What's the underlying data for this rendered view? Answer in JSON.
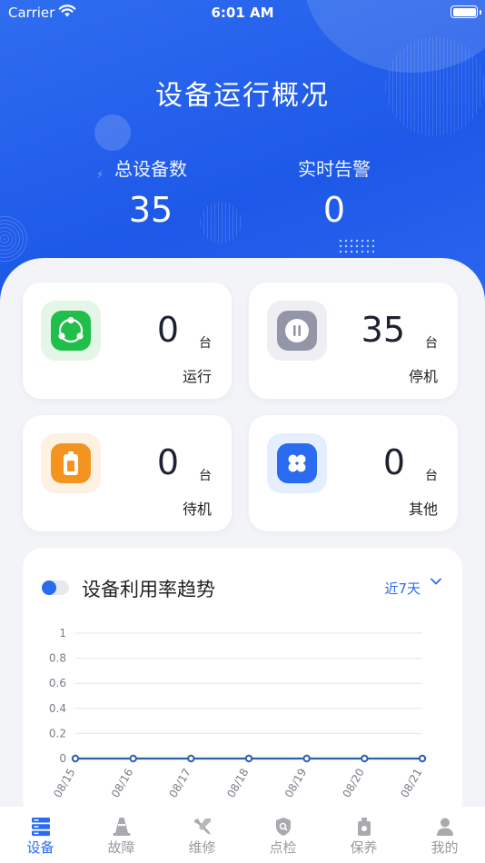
{
  "status_bar": {
    "carrier": "Carrier",
    "time": "6:01 AM"
  },
  "header": {
    "title": "设备运行概况",
    "total_label": "总设备数",
    "total_value": "35",
    "alarm_label": "实时告警",
    "alarm_value": "0"
  },
  "cards": [
    {
      "num": "0",
      "unit": "台",
      "label": "运行",
      "icon": "share-icon",
      "color": "#1fbf4a"
    },
    {
      "num": "35",
      "unit": "台",
      "label": "停机",
      "icon": "pause-icon",
      "color": "#9496a8"
    },
    {
      "num": "0",
      "unit": "台",
      "label": "待机",
      "icon": "battery-icon",
      "color": "#f39320"
    },
    {
      "num": "0",
      "unit": "台",
      "label": "其他",
      "icon": "grid-icon",
      "color": "#2a6bef"
    }
  ],
  "chart_section": {
    "title": "设备利用率趋势",
    "range": "近7天"
  },
  "chart_data": {
    "type": "line",
    "title": "",
    "xlabel": "",
    "ylabel": "",
    "x": [
      "08/15",
      "08/16",
      "08/17",
      "08/18",
      "08/19",
      "08/20",
      "08/21"
    ],
    "series": [
      {
        "values": [
          0,
          0,
          0,
          0,
          0,
          0,
          0
        ]
      }
    ],
    "y_ticks": [
      "1",
      "0.8",
      "0.6",
      "0.4",
      "0.2",
      "0"
    ],
    "ylim": [
      0,
      1
    ],
    "grid": true,
    "color": "#2f5fb0"
  },
  "tabs": [
    {
      "label": "设备",
      "icon": "device-icon",
      "active": true
    },
    {
      "label": "故障",
      "icon": "cone-icon",
      "active": false
    },
    {
      "label": "维修",
      "icon": "tools-icon",
      "active": false
    },
    {
      "label": "点检",
      "icon": "shield-icon",
      "active": false
    },
    {
      "label": "保养",
      "icon": "oilcan-icon",
      "active": false
    },
    {
      "label": "我的",
      "icon": "user-icon",
      "active": false
    }
  ]
}
